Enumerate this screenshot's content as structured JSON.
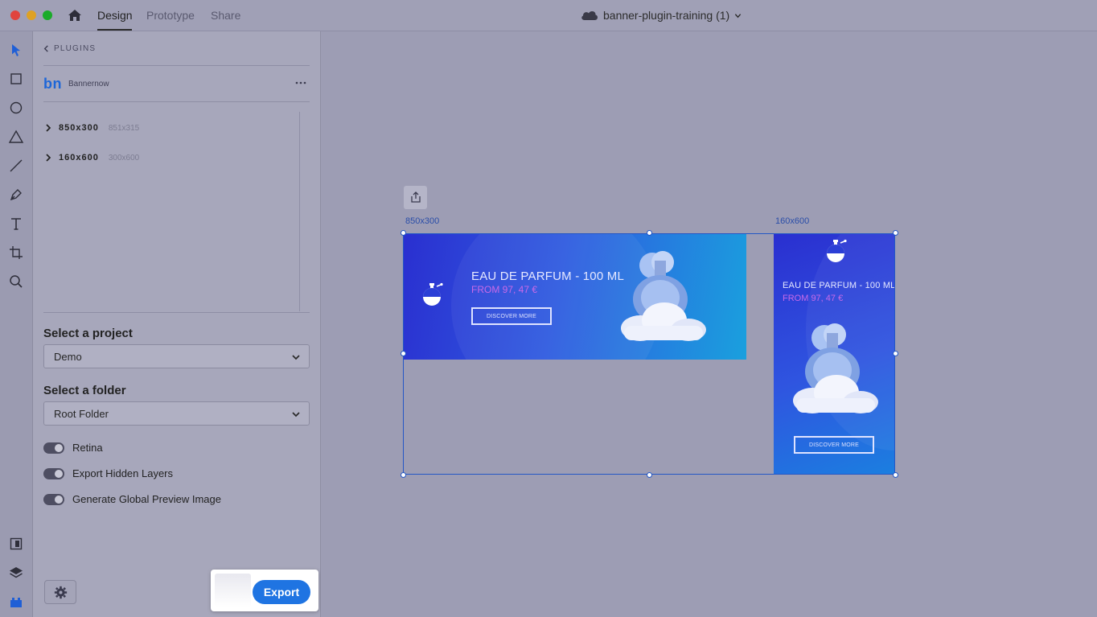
{
  "window": {
    "tabs": [
      {
        "label": "Design",
        "active": true
      },
      {
        "label": "Prototype",
        "active": false
      },
      {
        "label": "Share",
        "active": false
      }
    ],
    "doc_title": "banner-plugin-training (1)"
  },
  "toolbar": {
    "tools": [
      "select-tool",
      "rectangle-tool",
      "ellipse-tool",
      "polygon-tool",
      "line-tool",
      "pen-tool",
      "text-tool",
      "artboard-tool",
      "zoom-tool"
    ],
    "bottom": [
      "assets-panel",
      "layers-panel",
      "plugins-panel"
    ]
  },
  "panel": {
    "back_label": "PLUGINS",
    "plugin_logo": "bn",
    "plugin_name": "Bannernow",
    "tree": [
      {
        "name": "850x300",
        "size": "851x315"
      },
      {
        "name": "160x600",
        "size": "300x600"
      }
    ],
    "project_label": "Select a project",
    "project_value": "Demo",
    "folder_label": "Select a folder",
    "folder_value": "Root Folder",
    "toggles": [
      {
        "label": "Retina",
        "on": true
      },
      {
        "label": "Export Hidden Layers",
        "on": true
      },
      {
        "label": "Generate Global Preview Image",
        "on": true
      }
    ],
    "export_label": "Export"
  },
  "canvas": {
    "artboards": [
      {
        "label": "850x300",
        "headline": "EAU DE PARFUM - 100 ML",
        "price": "FROM 97, 47 €",
        "cta": "DISCOVER MORE"
      },
      {
        "label": "160x600",
        "headline": "EAU DE PARFUM - 100 ML",
        "price": "FROM 97, 47 €",
        "cta": "DISCOVER MORE"
      }
    ]
  },
  "colors": {
    "accent": "#1f74e2",
    "banner_gradient_start": "#2a2fd0",
    "banner_gradient_end": "#1aa0de",
    "price": "#c96ae8"
  }
}
